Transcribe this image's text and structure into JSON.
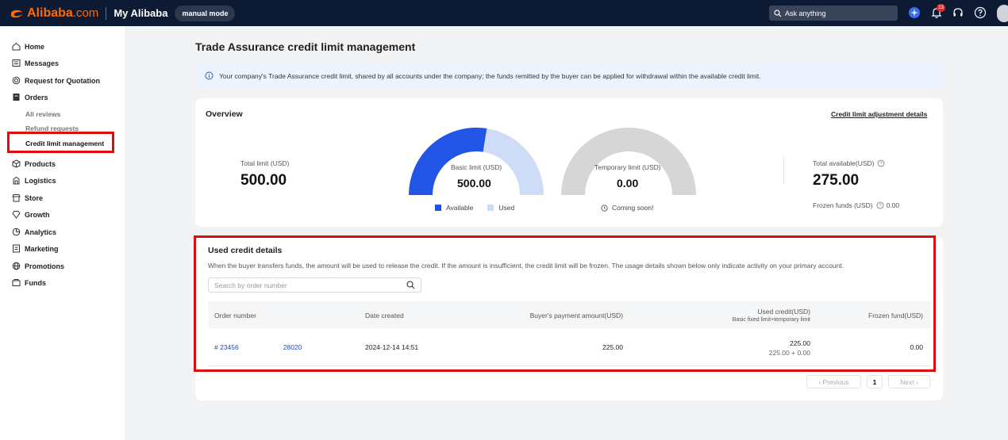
{
  "topbar": {
    "brand": "Alibaba",
    "brand_suffix": ".com",
    "section": "My Alibaba",
    "mode": "manual mode",
    "search_placeholder": "Ask anything",
    "notification_count": "13"
  },
  "sidebar": {
    "items": [
      {
        "label": "Home"
      },
      {
        "label": "Messages"
      },
      {
        "label": "Request for Quotation"
      },
      {
        "label": "Orders"
      },
      {
        "label": "Products"
      },
      {
        "label": "Logistics"
      },
      {
        "label": "Store"
      },
      {
        "label": "Growth"
      },
      {
        "label": "Analytics"
      },
      {
        "label": "Marketing"
      },
      {
        "label": "Promotions"
      },
      {
        "label": "Funds"
      }
    ],
    "order_sub": [
      "All reviews",
      "Refund requests",
      "Credit limit management"
    ]
  },
  "main": {
    "title": "Trade Assurance credit limit management",
    "info": "Your company's Trade Assurance credit limit, shared by all accounts under the company; the funds remitted by the buyer can be applied for withdrawal within the available credit limit."
  },
  "overview": {
    "title": "Overview",
    "adjust_link": "Credit limit adjustment details",
    "total_limit_label": "Total limit (USD)",
    "total_limit_value": "500.00",
    "basic_label": "Basic limit (USD)",
    "basic_value": "500.00",
    "basic_available_fraction": 0.55,
    "legend_available": "Available",
    "legend_used": "Used",
    "temp_label": "Temporary limit (USD)",
    "temp_value": "0.00",
    "coming_soon": "Coming soon!",
    "total_available_label": "Total available(USD)",
    "total_available_value": "275.00",
    "frozen_label": "Frozen funds (USD)",
    "frozen_value": "0.00",
    "colors": {
      "available": "#2254e6",
      "used": "#cfdcf5",
      "temp": "#d6d6d6"
    }
  },
  "used_credit": {
    "title": "Used credit details",
    "description": "When the buyer transfers funds, the amount will be used to release the credit. If the amount is insufficient, the credit limit will be frozen. The usage details shown below only indicate activity on your primary account.",
    "search_placeholder": "Search by order number",
    "columns": {
      "order": "Order number",
      "date": "Date created",
      "payment": "Buyer's payment amount(USD)",
      "used": "Used credit(USD)",
      "used_sub": "Basic fixed limit+temporary limit",
      "frozen": "Frozen fund(USD)"
    },
    "rows": [
      {
        "order_prefix": "# 23456",
        "order_suffix": "28020",
        "date": "2024-12-14 14:51",
        "payment": "225.00",
        "used": "225.00",
        "used_breakdown": "225.00 + 0.00",
        "frozen": "0.00"
      }
    ],
    "pagination": {
      "prev": "‹  Previous",
      "page": "1",
      "next": "Next  ›"
    }
  }
}
